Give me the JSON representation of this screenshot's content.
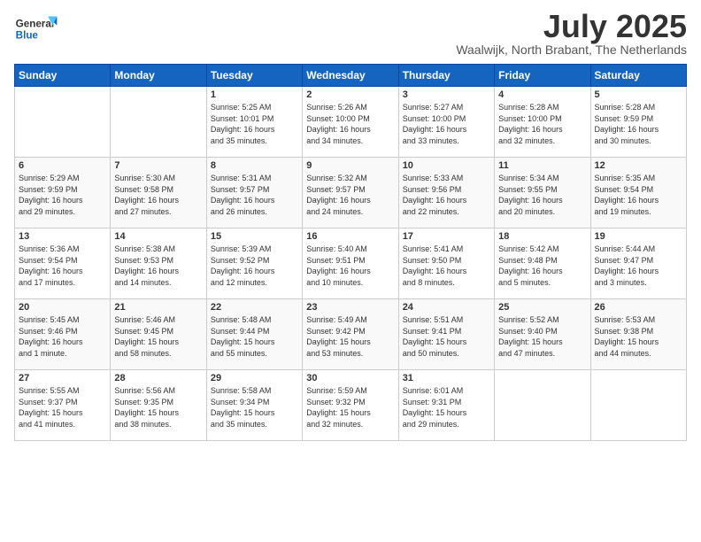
{
  "header": {
    "logo_general": "General",
    "logo_blue": "Blue",
    "month": "July 2025",
    "location": "Waalwijk, North Brabant, The Netherlands"
  },
  "days_of_week": [
    "Sunday",
    "Monday",
    "Tuesday",
    "Wednesday",
    "Thursday",
    "Friday",
    "Saturday"
  ],
  "weeks": [
    [
      {
        "day": "",
        "info": ""
      },
      {
        "day": "",
        "info": ""
      },
      {
        "day": "1",
        "info": "Sunrise: 5:25 AM\nSunset: 10:01 PM\nDaylight: 16 hours\nand 35 minutes."
      },
      {
        "day": "2",
        "info": "Sunrise: 5:26 AM\nSunset: 10:00 PM\nDaylight: 16 hours\nand 34 minutes."
      },
      {
        "day": "3",
        "info": "Sunrise: 5:27 AM\nSunset: 10:00 PM\nDaylight: 16 hours\nand 33 minutes."
      },
      {
        "day": "4",
        "info": "Sunrise: 5:28 AM\nSunset: 10:00 PM\nDaylight: 16 hours\nand 32 minutes."
      },
      {
        "day": "5",
        "info": "Sunrise: 5:28 AM\nSunset: 9:59 PM\nDaylight: 16 hours\nand 30 minutes."
      }
    ],
    [
      {
        "day": "6",
        "info": "Sunrise: 5:29 AM\nSunset: 9:59 PM\nDaylight: 16 hours\nand 29 minutes."
      },
      {
        "day": "7",
        "info": "Sunrise: 5:30 AM\nSunset: 9:58 PM\nDaylight: 16 hours\nand 27 minutes."
      },
      {
        "day": "8",
        "info": "Sunrise: 5:31 AM\nSunset: 9:57 PM\nDaylight: 16 hours\nand 26 minutes."
      },
      {
        "day": "9",
        "info": "Sunrise: 5:32 AM\nSunset: 9:57 PM\nDaylight: 16 hours\nand 24 minutes."
      },
      {
        "day": "10",
        "info": "Sunrise: 5:33 AM\nSunset: 9:56 PM\nDaylight: 16 hours\nand 22 minutes."
      },
      {
        "day": "11",
        "info": "Sunrise: 5:34 AM\nSunset: 9:55 PM\nDaylight: 16 hours\nand 20 minutes."
      },
      {
        "day": "12",
        "info": "Sunrise: 5:35 AM\nSunset: 9:54 PM\nDaylight: 16 hours\nand 19 minutes."
      }
    ],
    [
      {
        "day": "13",
        "info": "Sunrise: 5:36 AM\nSunset: 9:54 PM\nDaylight: 16 hours\nand 17 minutes."
      },
      {
        "day": "14",
        "info": "Sunrise: 5:38 AM\nSunset: 9:53 PM\nDaylight: 16 hours\nand 14 minutes."
      },
      {
        "day": "15",
        "info": "Sunrise: 5:39 AM\nSunset: 9:52 PM\nDaylight: 16 hours\nand 12 minutes."
      },
      {
        "day": "16",
        "info": "Sunrise: 5:40 AM\nSunset: 9:51 PM\nDaylight: 16 hours\nand 10 minutes."
      },
      {
        "day": "17",
        "info": "Sunrise: 5:41 AM\nSunset: 9:50 PM\nDaylight: 16 hours\nand 8 minutes."
      },
      {
        "day": "18",
        "info": "Sunrise: 5:42 AM\nSunset: 9:48 PM\nDaylight: 16 hours\nand 5 minutes."
      },
      {
        "day": "19",
        "info": "Sunrise: 5:44 AM\nSunset: 9:47 PM\nDaylight: 16 hours\nand 3 minutes."
      }
    ],
    [
      {
        "day": "20",
        "info": "Sunrise: 5:45 AM\nSunset: 9:46 PM\nDaylight: 16 hours\nand 1 minute."
      },
      {
        "day": "21",
        "info": "Sunrise: 5:46 AM\nSunset: 9:45 PM\nDaylight: 15 hours\nand 58 minutes."
      },
      {
        "day": "22",
        "info": "Sunrise: 5:48 AM\nSunset: 9:44 PM\nDaylight: 15 hours\nand 55 minutes."
      },
      {
        "day": "23",
        "info": "Sunrise: 5:49 AM\nSunset: 9:42 PM\nDaylight: 15 hours\nand 53 minutes."
      },
      {
        "day": "24",
        "info": "Sunrise: 5:51 AM\nSunset: 9:41 PM\nDaylight: 15 hours\nand 50 minutes."
      },
      {
        "day": "25",
        "info": "Sunrise: 5:52 AM\nSunset: 9:40 PM\nDaylight: 15 hours\nand 47 minutes."
      },
      {
        "day": "26",
        "info": "Sunrise: 5:53 AM\nSunset: 9:38 PM\nDaylight: 15 hours\nand 44 minutes."
      }
    ],
    [
      {
        "day": "27",
        "info": "Sunrise: 5:55 AM\nSunset: 9:37 PM\nDaylight: 15 hours\nand 41 minutes."
      },
      {
        "day": "28",
        "info": "Sunrise: 5:56 AM\nSunset: 9:35 PM\nDaylight: 15 hours\nand 38 minutes."
      },
      {
        "day": "29",
        "info": "Sunrise: 5:58 AM\nSunset: 9:34 PM\nDaylight: 15 hours\nand 35 minutes."
      },
      {
        "day": "30",
        "info": "Sunrise: 5:59 AM\nSunset: 9:32 PM\nDaylight: 15 hours\nand 32 minutes."
      },
      {
        "day": "31",
        "info": "Sunrise: 6:01 AM\nSunset: 9:31 PM\nDaylight: 15 hours\nand 29 minutes."
      },
      {
        "day": "",
        "info": ""
      },
      {
        "day": "",
        "info": ""
      }
    ]
  ]
}
